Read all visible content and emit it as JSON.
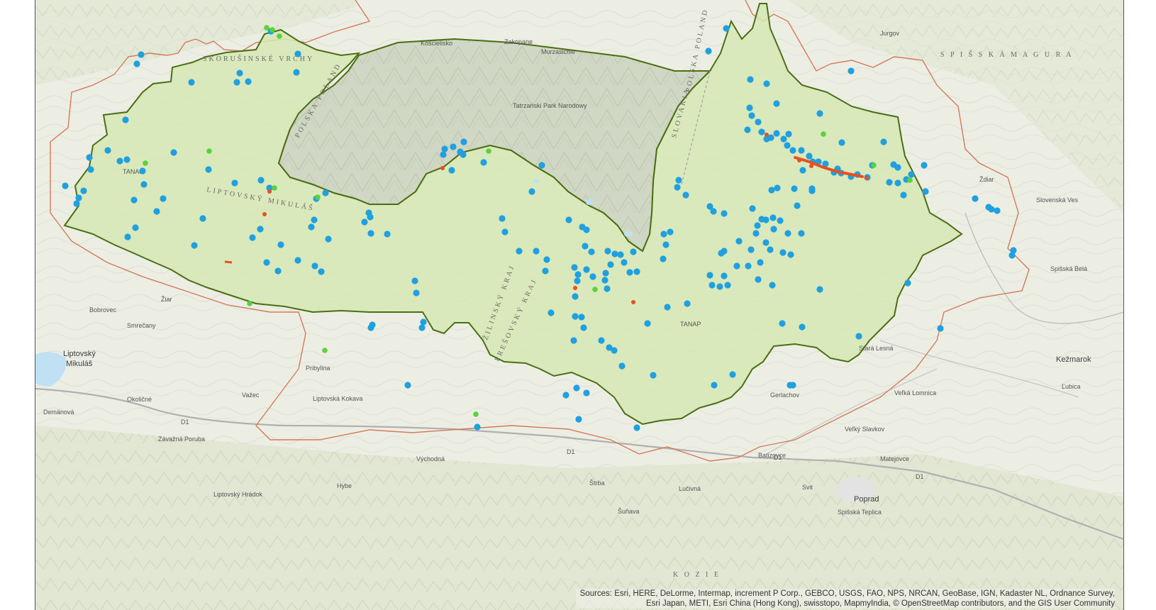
{
  "map": {
    "attribution": "Sources: Esri, HERE, DeLorme, Intermap, increment P Corp., GEBCO, USGS, FAO, NPS, NRCAN, GeoBase, IGN, Kadaster NL, Ordnance Survey, Esri Japan, METI, Esri China (Hong Kong), swisstopo, MapmyIndia, © OpenStreetMap contributors, and the GIS User Community",
    "colors": {
      "background": "#eef0e6",
      "park_fill": "#d6e7b4",
      "park_outline": "#4b6e14",
      "buffer_outline": "#d47a5a",
      "point_blue": "#1fa0e0",
      "point_green": "#5ad23c",
      "point_red": "#e8501e",
      "water": "#bfe1f3",
      "road": "#a8a8a8"
    },
    "labels": {
      "koscielisko": "Kościelisko",
      "zakopane": "Zakopane",
      "liptovsky_mikulas_1": "Liptovský",
      "liptovsky_mikulas_2": "Mikuláš",
      "kezmarok": "Kežmarok",
      "poprad": "Poprad",
      "stara_lesna": "Stará Lesná",
      "vazec": "Važec",
      "pribylina": "Pribylina",
      "skorusinske_vrchy": "SKORUŠINSKÉ VRCHY",
      "polska_poland_1": "POLSKA POLAND",
      "polska_poland_2": "POLSKA POLAND",
      "slovakia": "SLOVAKIA",
      "zilinsky_kraj": "ŽILINSKÝ KRAJ",
      "presovsky_kraj": "PREŠOVSKÝ KRAJ",
      "spisska_magura": "S P I Š S K Á   M A G U R A",
      "tanap_1": "TANAP",
      "tanap_2": "TANAP",
      "liptovsky_mikulas_region": "LIPTOVSKÝ MIKULÁŠ",
      "kozie": "K O Z I E",
      "zar": "Žiar",
      "bobrovec": "Bobrovec",
      "smrecany": "Smrečany",
      "okoliciane": "Okoličné",
      "demanova": "Demänová",
      "liptovska_kokava": "Liptovská Kokava",
      "vychodna": "Východná",
      "hybe": "Hybe",
      "tatranska_strba": "Štrba",
      "lucivna": "Lučivná",
      "velka_lomnica": "Veľká Lomnica",
      "velky_slavkov": "Veľký Slavkov",
      "matejovce": "Matejovce",
      "spisska_teplica": "Spišská Teplica",
      "zdiar": "Ždiar",
      "slovenska_ves": "Slovenská Ves",
      "spisska_bela": "Spišská Belá",
      "lubica": "Ľubica",
      "gerlachov": "Gerlachov",
      "batizovce": "Batizovce",
      "svit": "Svit",
      "suňava": "Šuňava",
      "kravany": "Kravany",
      "liptovsky_hradok": "Liptovský Hrádok",
      "zavazna_poruba": "Závažná Poruba",
      "jurgov": "Jurgov",
      "murzasichle": "Murzasichle",
      "tatrzanski_park": "Tatrzański Park Narodowy",
      "d1_1": "D1",
      "d1_2": "D1",
      "d1_3": "D1",
      "d1_4": "D1"
    }
  }
}
